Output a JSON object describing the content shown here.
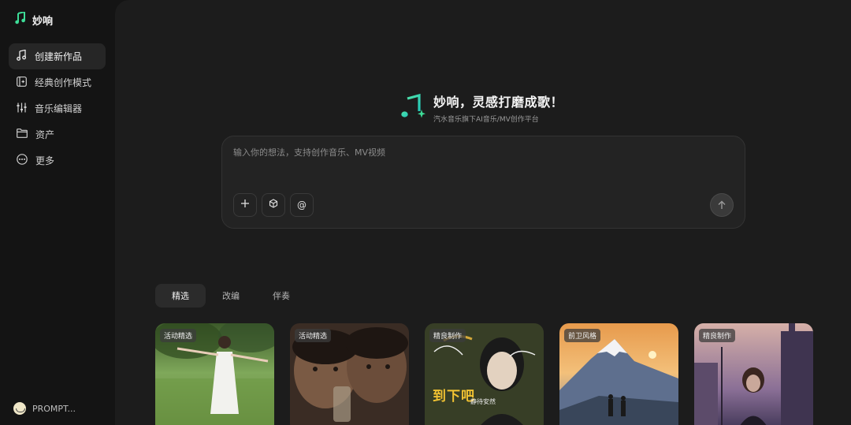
{
  "sidebar": {
    "brand": "妙响",
    "items": [
      {
        "label": "创建新作品",
        "icon": "music-note-icon",
        "active": true
      },
      {
        "label": "经典创作模式",
        "icon": "panel-plus-icon",
        "active": false
      },
      {
        "label": "音乐编辑器",
        "icon": "sliders-icon",
        "active": false
      },
      {
        "label": "资产",
        "icon": "folder-icon",
        "active": false
      },
      {
        "label": "更多",
        "icon": "more-circle-icon",
        "active": false
      }
    ],
    "user": "PROMPT..."
  },
  "hero": {
    "title": "妙响，灵感打磨成歌！",
    "subtitle": "汽水音乐旗下AI音乐/MV创作平台"
  },
  "prompt": {
    "placeholder": "输入你的想法，支持创作音乐、MV视频",
    "value": "",
    "tools": [
      "plus-icon",
      "cube-icon",
      "at-icon"
    ],
    "send_icon": "arrow-up-icon"
  },
  "tabs": [
    {
      "label": "精选",
      "active": true
    },
    {
      "label": "改编",
      "active": false
    },
    {
      "label": "伴奏",
      "active": false
    }
  ],
  "cards": [
    {
      "tag": "活动精选"
    },
    {
      "tag": "活动精选"
    },
    {
      "tag": "精良制作",
      "poster_text": "到下吧",
      "poster_sub": "静待安然"
    },
    {
      "tag": "前卫风格"
    },
    {
      "tag": "精良制作"
    }
  ],
  "colors": {
    "brand_green": "#3ddc97",
    "brand_cyan": "#2fd1c5",
    "background": "#141414",
    "panel": "#1c1c1c"
  }
}
